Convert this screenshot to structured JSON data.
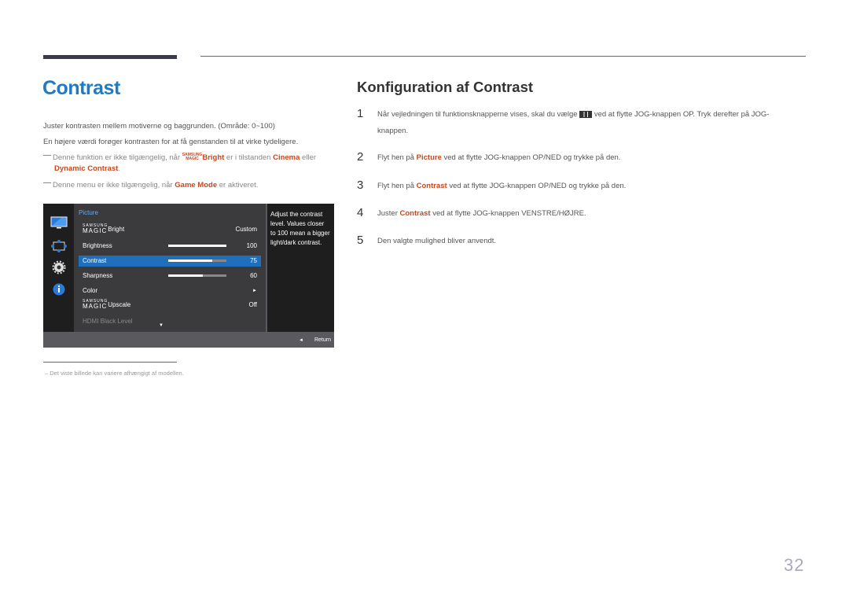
{
  "page": {
    "title": "Contrast",
    "page_number": "32"
  },
  "intro": {
    "line1": "Juster kontrasten mellem motiverne og baggrunden. (Område: 0~100)",
    "line2": "En højere værdi forøger kontrasten for at få genstanden til at virke tydeligere.",
    "note1": {
      "pre": "Denne funktion er ikke tilgængelig, når ",
      "magic_top": "SAMSUNG",
      "magic_bottom": "MAGIC",
      "bright": "Bright",
      "mid": " er i tilstanden ",
      "cinema": "Cinema",
      "or": " eller",
      "dynamic": "Dynamic Contrast",
      "end": "."
    },
    "note2": {
      "pre": "Denne menu er ikke tilgængelig, når ",
      "game_mode": "Game Mode",
      "post": " er aktiveret."
    }
  },
  "osd": {
    "header": "Picture",
    "help_text": "Adjust the contrast level. Values closer to 100 mean a bigger light/dark contrast.",
    "return_label": "Return",
    "items": [
      {
        "label_top": "SAMSUNG",
        "label_magic": "MAGIC",
        "label": "Bright",
        "value": "Custom"
      },
      {
        "label": "Brightness",
        "value": "100",
        "level": 100
      },
      {
        "label": "Contrast",
        "value": "75",
        "level": 75,
        "selected": true
      },
      {
        "label": "Sharpness",
        "value": "60",
        "level": 60
      },
      {
        "label": "Color",
        "value": "►"
      },
      {
        "label_top": "SAMSUNG",
        "label_magic": "MAGIC",
        "label": "Upscale",
        "value": "Off"
      },
      {
        "label": "HDMI Black Level",
        "value": "",
        "disabled": true
      }
    ],
    "side_icons": [
      "picture-icon",
      "onscreen-display-icon",
      "gear-icon",
      "info-icon"
    ]
  },
  "config": {
    "heading": "Konfiguration af Contrast",
    "steps": [
      {
        "num": "1",
        "pre": "Når vejledningen til funktionsknapperne vises, skal du vælge ",
        "post": " ved at flytte JOG-knappen OP. Tryk derefter på JOG-",
        "line2": "knappen."
      },
      {
        "num": "2",
        "pre": "Flyt hen på ",
        "hl": "Picture",
        "post": " ved at flytte JOG-knappen OP/NED og trykke på den."
      },
      {
        "num": "3",
        "pre": "Flyt hen på ",
        "hl": "Contrast",
        "post": " ved at flytte JOG-knappen OP/NED og trykke på den."
      },
      {
        "num": "4",
        "pre": "Juster ",
        "hl": "Contrast",
        "post": " ved at flytte JOG-knappen VENSTRE/HØJRE."
      },
      {
        "num": "5",
        "pre": "Den valgte mulighed bliver anvendt."
      }
    ]
  },
  "footnote": "Det viste billede kan variere afhængigt af modellen."
}
